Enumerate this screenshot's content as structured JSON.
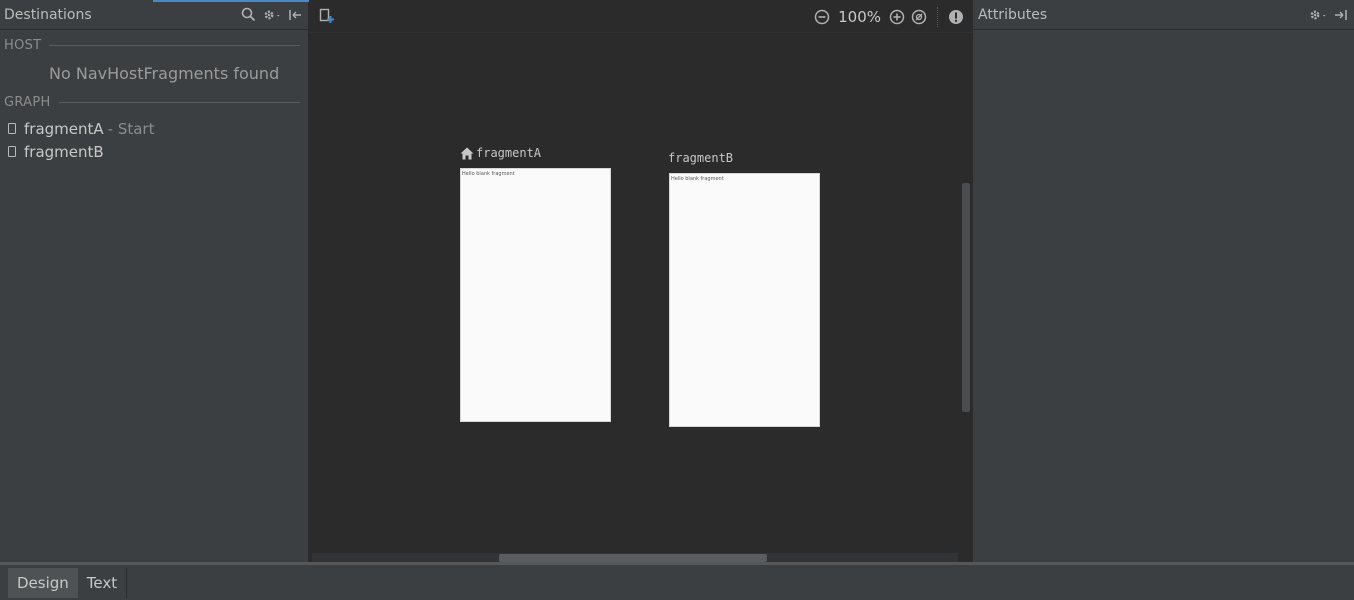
{
  "destinations_panel": {
    "title": "Destinations",
    "icons": [
      "search-icon",
      "gear-icon",
      "collapse-icon"
    ],
    "host": {
      "label": "HOST",
      "empty_message": "No NavHostFragments found"
    },
    "graph": {
      "label": "GRAPH",
      "items": [
        {
          "name": "fragmentA",
          "suffix": "- Start"
        },
        {
          "name": "fragmentB",
          "suffix": ""
        }
      ]
    }
  },
  "canvas": {
    "toolbar": {
      "zoom_level": "100%",
      "icons": [
        "new-destination-icon",
        "zoom-out-icon",
        "zoom-in-icon",
        "zoom-to-fit-icon",
        "warning-icon"
      ]
    },
    "fragments": [
      {
        "label": "fragmentA",
        "is_start": true,
        "preview_text": "Hello blank fragment"
      },
      {
        "label": "fragmentB",
        "is_start": false,
        "preview_text": "Hello blank fragment"
      }
    ]
  },
  "attributes_panel": {
    "title": "Attributes",
    "icons": [
      "gear-icon",
      "hide-panel-icon"
    ]
  },
  "bottom_tabs": [
    {
      "label": "Design",
      "active": true
    },
    {
      "label": "Text",
      "active": false
    }
  ],
  "colors": {
    "panel_bg": "#3c3f41",
    "canvas_bg": "#2b2b2b",
    "accent": "#4a88c7"
  }
}
